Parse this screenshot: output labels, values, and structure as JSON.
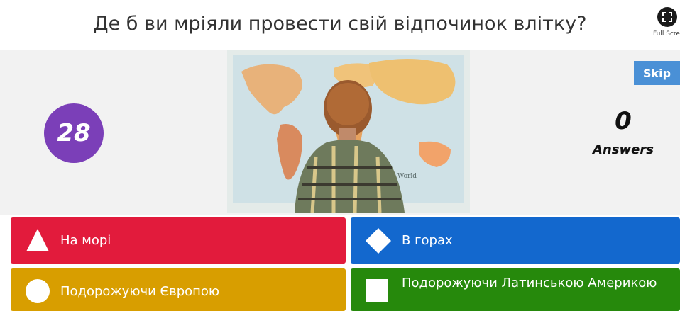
{
  "header": {
    "question": "Де б ви мріяли провести свій відпочинок влітку?",
    "fullscreen_label": "Full Scree"
  },
  "stage": {
    "timer": "28",
    "skip_label": "Skip",
    "answer_count": "0",
    "answer_count_label": "Answers",
    "image_map_label": "World",
    "image_icon": "boy-looking-at-world-map-image"
  },
  "answers": [
    {
      "label": "На морі",
      "shape": "triangle-icon",
      "color": "#e21b3c"
    },
    {
      "label": "В горах",
      "shape": "diamond-icon",
      "color": "#1368ce"
    },
    {
      "label": "Подорожуючи Європою",
      "shape": "circle-icon",
      "color": "#d89e00"
    },
    {
      "label": "Подорожуючи Латинською Америкою",
      "shape": "square-icon",
      "color": "#26890c"
    }
  ],
  "colors": {
    "timer_bg": "#7b3fb8",
    "skip_bg": "#4a90d6",
    "stage_bg": "#f2f2f2"
  }
}
